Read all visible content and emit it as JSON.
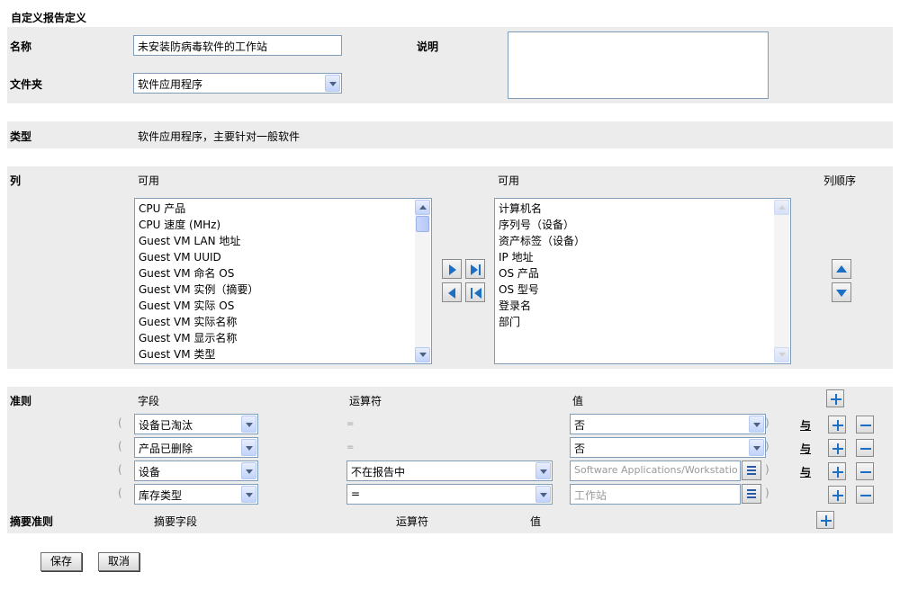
{
  "page_title": "自定义报告定义",
  "name_label": "名称",
  "name_value": "未安装防病毒软件的工作站",
  "folder_label": "文件夹",
  "folder_value": "软件应用程序",
  "desc_label": "说明",
  "type_label": "类型",
  "type_value": "软件应用程序，主要针对一般软件",
  "columns": {
    "label": "列",
    "available_header": "可用",
    "selected_header": "可用",
    "order_header": "列顺序",
    "available_items": [
      "CPU 产品",
      "CPU 速度 (MHz)",
      "Guest VM LAN 地址",
      "Guest VM UUID",
      "Guest VM 命名 OS",
      "Guest VM 实例（摘要）",
      "Guest VM 实际 OS",
      "Guest VM 实际名称",
      "Guest VM 显示名称",
      "Guest VM 类型"
    ],
    "selected_items": [
      "计算机名",
      "序列号（设备）",
      "资产标签（设备）",
      "IP 地址",
      "OS 产品",
      "OS 型号",
      "登录名",
      "部门"
    ]
  },
  "criteria": {
    "label": "准则",
    "field_header": "字段",
    "operator_header": "运算符",
    "value_header": "值",
    "rows": [
      {
        "open": "(",
        "field": "设备已淘汰",
        "operator": "=",
        "value": "否",
        "close": ")",
        "connector": "与"
      },
      {
        "open": "(",
        "field": "产品已删除",
        "operator": "=",
        "value": "否",
        "close": ")",
        "connector": "与"
      },
      {
        "open": "(",
        "field": "设备",
        "operator": "不在报告中",
        "value": "Software Applications/Workstatio",
        "close": ")",
        "connector": "与"
      },
      {
        "open": "(",
        "field": "库存类型",
        "operator": "=",
        "value": "工作站",
        "close": ")"
      }
    ]
  },
  "summary": {
    "label": "摘要准则",
    "field_header": "摘要字段",
    "operator_header": "运算符",
    "value_header": "值"
  },
  "buttons": {
    "save": "保存",
    "cancel": "取消"
  }
}
